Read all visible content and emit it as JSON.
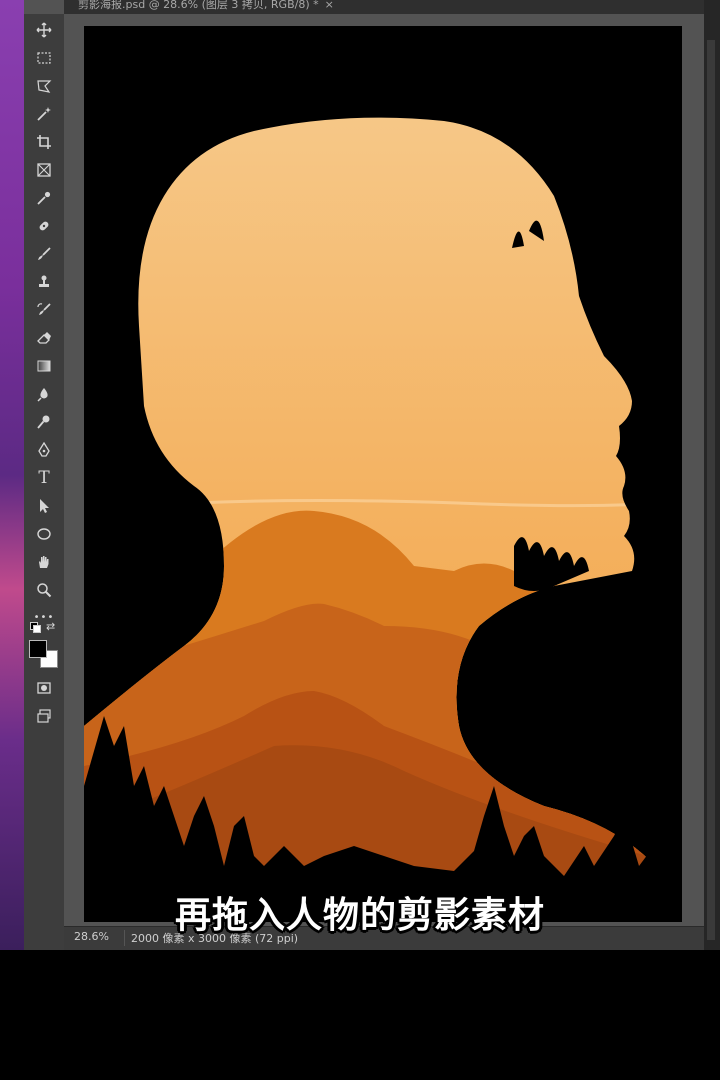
{
  "document_tab": {
    "title": "剪影海报.psd @ 28.6% (图层 3 拷贝, RGB/8) *",
    "close_glyph": "×"
  },
  "toolbar": {
    "tools": [
      {
        "name": "move-tool-icon"
      },
      {
        "name": "marquee-tool-icon"
      },
      {
        "name": "lasso-tool-icon"
      },
      {
        "name": "magic-wand-tool-icon"
      },
      {
        "name": "crop-tool-icon"
      },
      {
        "name": "frame-tool-icon"
      },
      {
        "name": "eyedropper-tool-icon"
      },
      {
        "name": "healing-brush-tool-icon"
      },
      {
        "name": "brush-tool-icon"
      },
      {
        "name": "clone-stamp-tool-icon"
      },
      {
        "name": "history-brush-tool-icon"
      },
      {
        "name": "eraser-tool-icon"
      },
      {
        "name": "gradient-tool-icon"
      },
      {
        "name": "blur-tool-icon"
      },
      {
        "name": "dodge-tool-icon"
      },
      {
        "name": "pen-tool-icon"
      },
      {
        "name": "type-tool-icon",
        "glyph": "T"
      },
      {
        "name": "path-selection-tool-icon"
      },
      {
        "name": "ellipse-tool-icon"
      },
      {
        "name": "hand-tool-icon"
      },
      {
        "name": "zoom-tool-icon"
      },
      {
        "name": "more-tools-icon",
        "glyph": "•••"
      }
    ],
    "foreground_color": "#000000",
    "background_color": "#ffffff"
  },
  "status_bar": {
    "zoom": "28.6%",
    "doc_info": "2000 像素 x 3000 像素 (72 ppi)"
  },
  "artwork": {
    "sky_top": "#f6c98a",
    "sky_bottom": "#f0a040",
    "mountain_colors": [
      "#d97a1f",
      "#c8641a",
      "#b85214",
      "#a84a12"
    ],
    "silhouette_color": "#000000"
  },
  "caption": "再拖入人物的剪影素材"
}
